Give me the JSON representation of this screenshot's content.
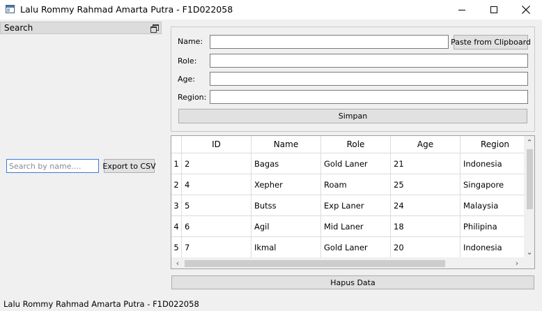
{
  "window": {
    "title": "Lalu Rommy Rahmad Amarta Putra - F1D022058",
    "icon": "app-window-icon"
  },
  "dock": {
    "title": "Search",
    "search_placeholder": "Search by name....",
    "search_value": "",
    "export_label": "Export to CSV"
  },
  "form": {
    "name_label": "Name:",
    "name_value": "",
    "paste_label": "Paste from Clipboard",
    "role_label": "Role:",
    "role_value": "",
    "age_label": "Age:",
    "age_value": "",
    "region_label": "Region:",
    "region_value": "",
    "save_label": "Simpan"
  },
  "table": {
    "columns": [
      "ID",
      "Name",
      "Role",
      "Age",
      "Region"
    ],
    "row_headers": [
      "1",
      "2",
      "3",
      "4",
      "5"
    ],
    "rows": [
      [
        "2",
        "Bagas",
        "Gold Laner",
        "21",
        "Indonesia"
      ],
      [
        "4",
        "Xepher",
        "Roam",
        "25",
        "Singapore"
      ],
      [
        "5",
        "Butss",
        "Exp Laner",
        "24",
        "Malaysia"
      ],
      [
        "6",
        "Agil",
        "Mid Laner",
        "18",
        "Philipina"
      ],
      [
        "7",
        "Ikmal",
        "Gold Laner",
        "20",
        "Indonesia"
      ]
    ]
  },
  "delete_label": "Hapus Data",
  "statusbar": {
    "text": "Lalu Rommy Rahmad Amarta Putra - F1D022058"
  },
  "colors": {
    "window_bg": "#f0f0f0",
    "focus_border": "#3a7bd5",
    "button_bg": "#e1e1e1"
  }
}
